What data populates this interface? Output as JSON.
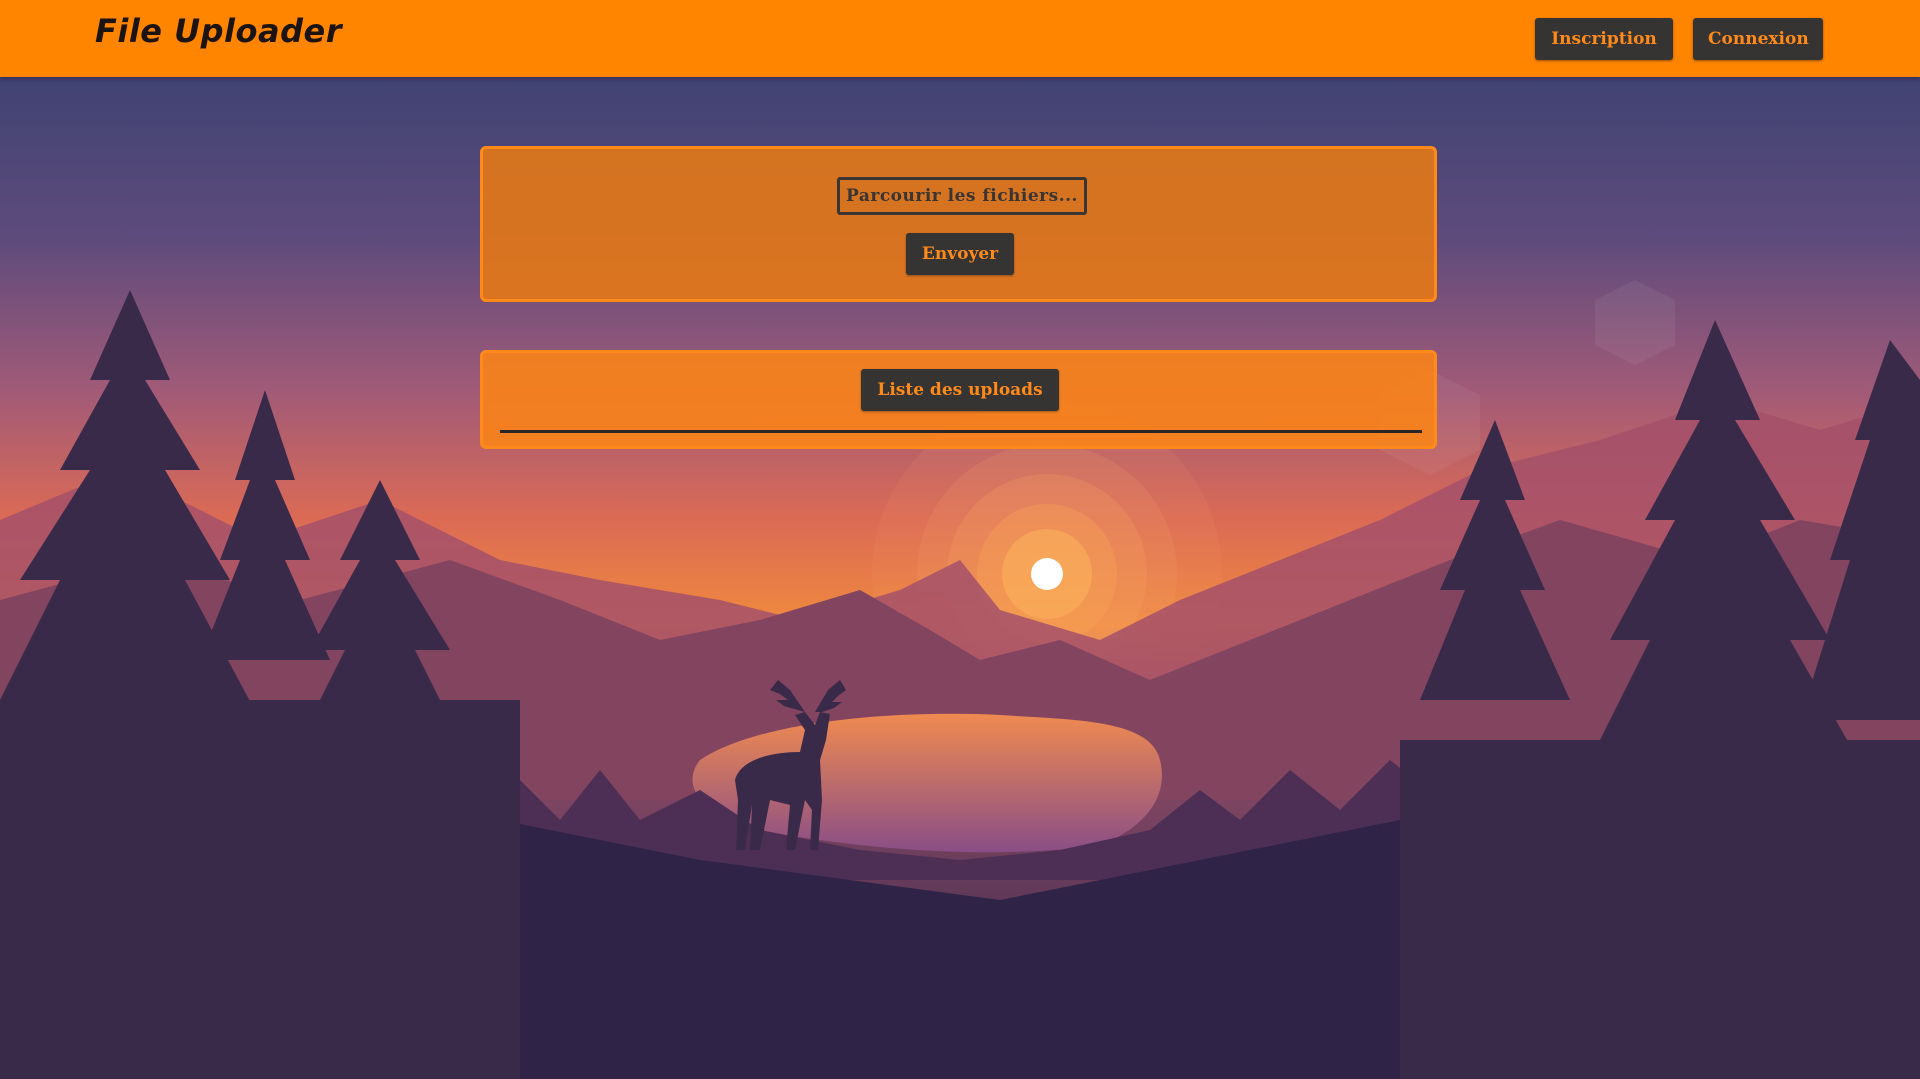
{
  "app": {
    "brand": "File Uploader"
  },
  "navbar": {
    "register_label": "Inscription",
    "login_label": "Connexion",
    "background_color": "#ff8400"
  },
  "upload_panel": {
    "file_picker_label": "Parcourir les fichiers...",
    "send_label": "Envoyer"
  },
  "uploads_panel": {
    "list_label": "Liste des uploads"
  },
  "colors": {
    "accent": "#ff8a1a",
    "button_dark": "#353433",
    "sky_top": "#323f6e",
    "ground": "#2d2347"
  },
  "background": {
    "scene": "deer-at-sunset-landscape"
  }
}
